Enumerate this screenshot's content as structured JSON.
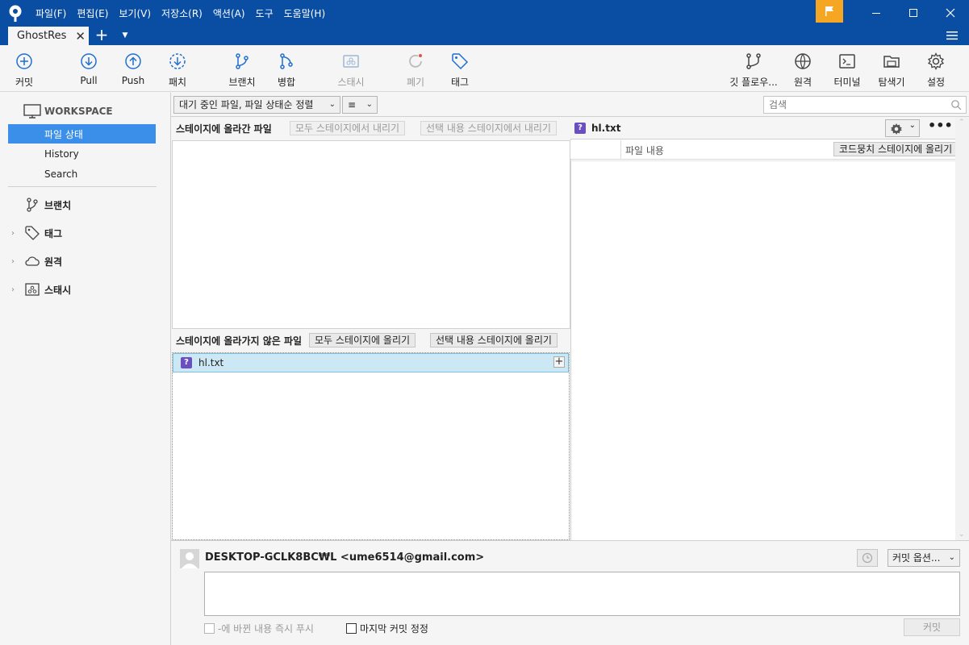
{
  "menu": [
    "파일(F)",
    "편집(E)",
    "보기(V)",
    "저장소(R)",
    "액션(A)",
    "도구",
    "도움말(H)"
  ],
  "tab": {
    "label": "GhostRes"
  },
  "toolbar": {
    "commit": "커밋",
    "pull": "Pull",
    "push": "Push",
    "fetch": "패치",
    "branch": "브랜치",
    "merge": "병합",
    "stash": "스태시",
    "discard": "폐기",
    "tag": "태그",
    "gitflow": "깃 플로우...",
    "remote": "원격",
    "terminal": "터미널",
    "explorer": "탐색기",
    "settings": "설정"
  },
  "sidebar": {
    "workspace": "WORKSPACE",
    "file_status": "파일 상태",
    "history": "History",
    "search": "Search",
    "branches": "브랜치",
    "tags": "태그",
    "remotes": "원격",
    "stashes": "스태시"
  },
  "filter": {
    "sort": "대기 중인 파일, 파일 상태순 정렬",
    "view": "≡",
    "search_placeholder": "검색"
  },
  "staged": {
    "title": "스테이지에 올라간 파일",
    "unstage_all": "모두 스테이지에서 내리기",
    "unstage_selected": "선택 내용 스테이지에서 내리기"
  },
  "unstaged": {
    "title": "스테이지에 올라가지 않은 파일",
    "stage_all": "모두 스테이지에 올리기",
    "stage_selected": "선택 내용 스테이지에 올리기",
    "files": [
      {
        "name": "hl.txt",
        "status": "?"
      }
    ]
  },
  "diff": {
    "file": "hl.txt",
    "column": "파일 내용",
    "stage_hunk": "코드뭉치 스테이지에 올리기"
  },
  "commit": {
    "author": "DESKTOP-GCLK8BC₩L <ume6514@gmail.com>",
    "options": "커밋 옵션...",
    "push_immediately": "-에 바뀐 내용 즉시 푸시",
    "amend": "마지막 커밋 정정",
    "button": "커밋"
  },
  "colors": {
    "titlebar": "#0a4ea3",
    "selection": "#3b8fe8",
    "accent": "#1f6fd0",
    "flag": "#f5a623"
  }
}
